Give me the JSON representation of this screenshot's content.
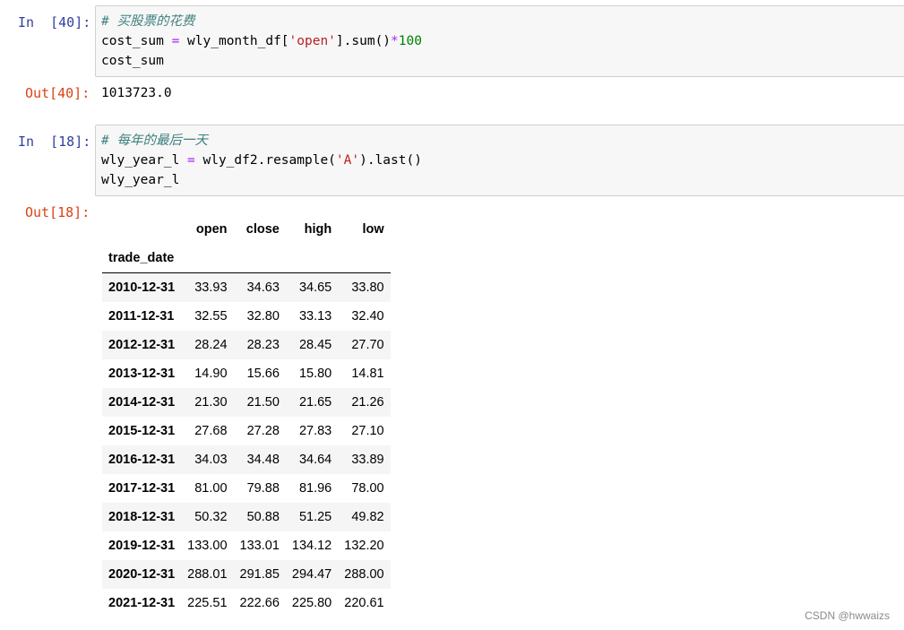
{
  "cells": [
    {
      "in_prompt": "In  [40]:",
      "code": [
        "# 买股票的花费",
        "cost_sum = wly_month_df['open'].sum()*100",
        "cost_sum"
      ],
      "out_prompt": "Out[40]:",
      "output": "1013723.0"
    },
    {
      "in_prompt": "In  [18]:",
      "code": [
        "# 每年的最后一天",
        "wly_year_l = wly_df2.resample('A').last()",
        "wly_year_l"
      ],
      "out_prompt": "Out[18]:"
    }
  ],
  "dataframe": {
    "columns": [
      "open",
      "close",
      "high",
      "low"
    ],
    "index_name": "trade_date",
    "rows": [
      {
        "index": "2010-12-31",
        "values": [
          "33.93",
          "34.63",
          "34.65",
          "33.80"
        ]
      },
      {
        "index": "2011-12-31",
        "values": [
          "32.55",
          "32.80",
          "33.13",
          "32.40"
        ]
      },
      {
        "index": "2012-12-31",
        "values": [
          "28.24",
          "28.23",
          "28.45",
          "27.70"
        ]
      },
      {
        "index": "2013-12-31",
        "values": [
          "14.90",
          "15.66",
          "15.80",
          "14.81"
        ]
      },
      {
        "index": "2014-12-31",
        "values": [
          "21.30",
          "21.50",
          "21.65",
          "21.26"
        ]
      },
      {
        "index": "2015-12-31",
        "values": [
          "27.68",
          "27.28",
          "27.83",
          "27.10"
        ]
      },
      {
        "index": "2016-12-31",
        "values": [
          "34.03",
          "34.48",
          "34.64",
          "33.89"
        ]
      },
      {
        "index": "2017-12-31",
        "values": [
          "81.00",
          "79.88",
          "81.96",
          "78.00"
        ]
      },
      {
        "index": "2018-12-31",
        "values": [
          "50.32",
          "50.88",
          "51.25",
          "49.82"
        ]
      },
      {
        "index": "2019-12-31",
        "values": [
          "133.00",
          "133.01",
          "134.12",
          "132.20"
        ]
      },
      {
        "index": "2020-12-31",
        "values": [
          "288.01",
          "291.85",
          "294.47",
          "288.00"
        ]
      },
      {
        "index": "2021-12-31",
        "values": [
          "225.51",
          "222.66",
          "225.80",
          "220.61"
        ]
      }
    ]
  },
  "watermark": "CSDN @hwwaizs",
  "colors": {
    "in_prompt": "#303f9f",
    "out_prompt": "#d84315",
    "comment": "#408080",
    "operator": "#aa22ff",
    "number": "#008000",
    "string": "#ba2121",
    "input_bg": "#f7f7f7",
    "input_border": "#cfcfcf",
    "row_stripe": "#f5f5f5"
  }
}
